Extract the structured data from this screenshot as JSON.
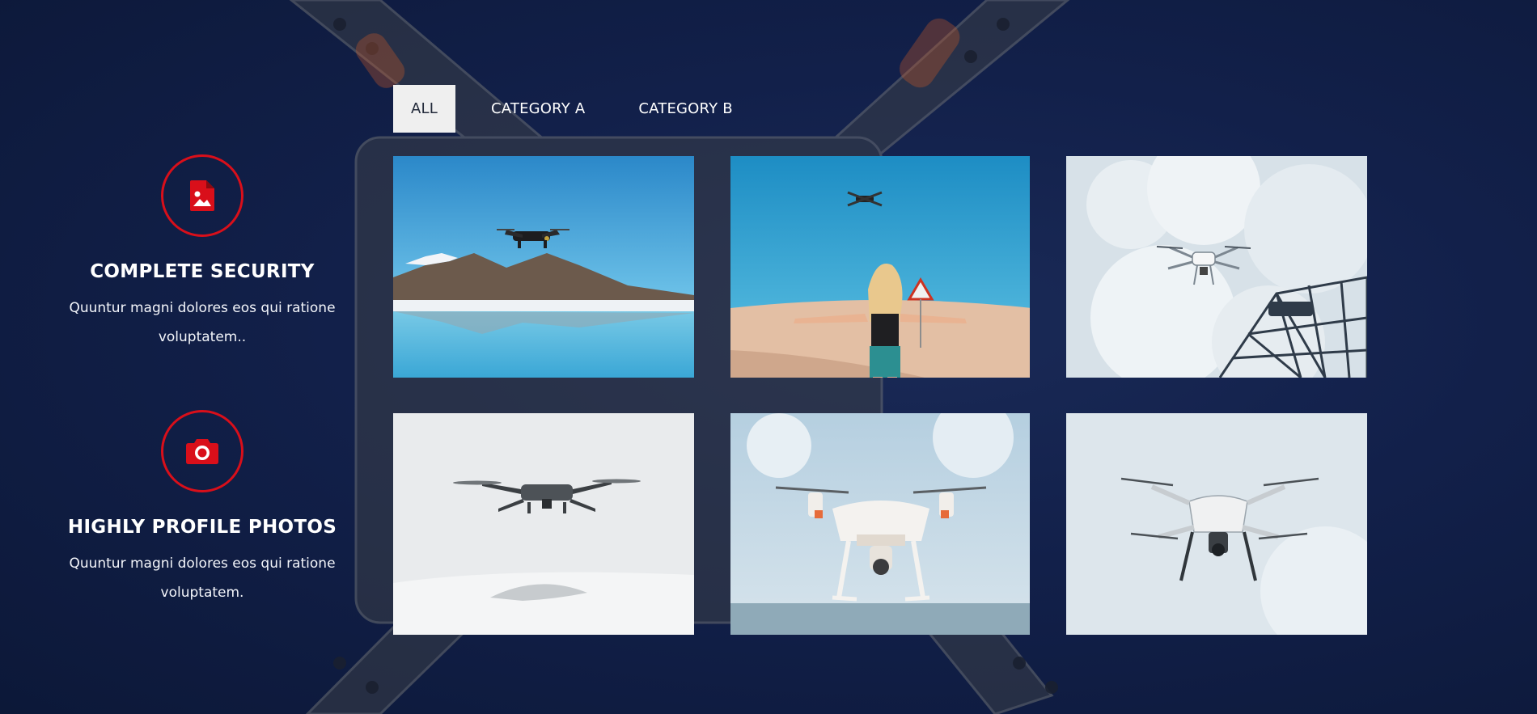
{
  "filters": {
    "tabs": [
      {
        "label": "ALL",
        "active": true
      },
      {
        "label": "CATEGORY A",
        "active": false
      },
      {
        "label": "CATEGORY B",
        "active": false
      }
    ]
  },
  "features": [
    {
      "icon": "image-file-icon",
      "title": "COMPLETE SECURITY",
      "text": "Quuntur magni dolores eos qui ratione voluptatem.."
    },
    {
      "icon": "camera-icon",
      "title": "HIGHLY PROFILE PHOTOS",
      "text": "Quuntur magni dolores eos qui ratione voluptatem."
    }
  ],
  "gallery": {
    "items": [
      {
        "subject": "drone over mountain lake"
      },
      {
        "subject": "woman with drone in desert"
      },
      {
        "subject": "drone near scaffolding and clouds"
      },
      {
        "subject": "foldable drone over snow"
      },
      {
        "subject": "white quadcopter in sky"
      },
      {
        "subject": "white drone close-up"
      }
    ]
  },
  "colors": {
    "background": "#12204a",
    "accent_red": "#d90f1a",
    "active_tab": "#efefef"
  }
}
